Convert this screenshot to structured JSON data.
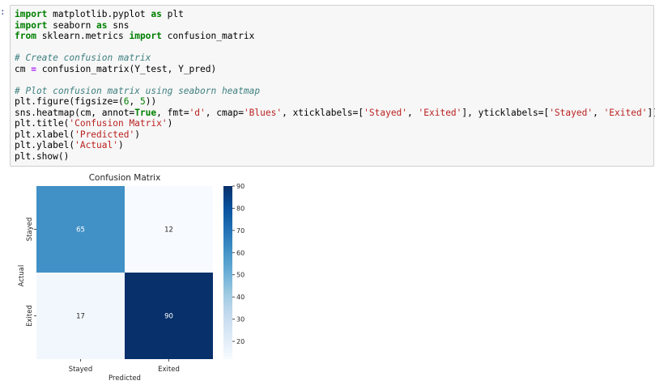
{
  "cell": {
    "prompt": ":",
    "lines": [
      [
        {
          "t": "import",
          "c": "kw"
        },
        {
          "t": " matplotlib.pyplot ",
          "c": ""
        },
        {
          "t": "as",
          "c": "kw"
        },
        {
          "t": " plt",
          "c": ""
        }
      ],
      [
        {
          "t": "import",
          "c": "kw"
        },
        {
          "t": " seaborn ",
          "c": ""
        },
        {
          "t": "as",
          "c": "kw"
        },
        {
          "t": " sns",
          "c": ""
        }
      ],
      [
        {
          "t": "from",
          "c": "kw"
        },
        {
          "t": " sklearn.metrics ",
          "c": ""
        },
        {
          "t": "import",
          "c": "kw"
        },
        {
          "t": " confusion_matrix",
          "c": ""
        }
      ],
      [],
      [
        {
          "t": "# Create confusion matrix",
          "c": "cm"
        }
      ],
      [
        {
          "t": "cm ",
          "c": ""
        },
        {
          "t": "=",
          "c": "op"
        },
        {
          "t": " confusion_matrix(Y_test, Y_pred)",
          "c": ""
        }
      ],
      [],
      [
        {
          "t": "# Plot confusion matrix using seaborn heatmap",
          "c": "cm"
        }
      ],
      [
        {
          "t": "plt.figure(figsize=(",
          "c": ""
        },
        {
          "t": "6",
          "c": "nu"
        },
        {
          "t": ", ",
          "c": ""
        },
        {
          "t": "5",
          "c": "nu"
        },
        {
          "t": "))",
          "c": ""
        }
      ],
      [
        {
          "t": "sns.heatmap(cm, annot=",
          "c": ""
        },
        {
          "t": "True",
          "c": "kw"
        },
        {
          "t": ", fmt=",
          "c": ""
        },
        {
          "t": "'d'",
          "c": "st"
        },
        {
          "t": ", cmap=",
          "c": ""
        },
        {
          "t": "'Blues'",
          "c": "st"
        },
        {
          "t": ", xticklabels=[",
          "c": ""
        },
        {
          "t": "'Stayed'",
          "c": "st"
        },
        {
          "t": ", ",
          "c": ""
        },
        {
          "t": "'Exited'",
          "c": "st"
        },
        {
          "t": "], yticklabels=[",
          "c": ""
        },
        {
          "t": "'Stayed'",
          "c": "st"
        },
        {
          "t": ", ",
          "c": ""
        },
        {
          "t": "'Exited'",
          "c": "st"
        },
        {
          "t": "])",
          "c": ""
        }
      ],
      [
        {
          "t": "plt.title(",
          "c": ""
        },
        {
          "t": "'Confusion Matrix'",
          "c": "st"
        },
        {
          "t": ")",
          "c": ""
        }
      ],
      [
        {
          "t": "plt.xlabel(",
          "c": ""
        },
        {
          "t": "'Predicted'",
          "c": "st"
        },
        {
          "t": ")",
          "c": ""
        }
      ],
      [
        {
          "t": "plt.ylabel(",
          "c": ""
        },
        {
          "t": "'Actual'",
          "c": "st"
        },
        {
          "t": ")",
          "c": ""
        }
      ],
      [
        {
          "t": "plt.show()",
          "c": ""
        }
      ]
    ]
  },
  "chart_data": {
    "type": "heatmap",
    "title": "Confusion Matrix",
    "xlabel": "Predicted",
    "ylabel": "Actual",
    "x_categories": [
      "Stayed",
      "Exited"
    ],
    "y_categories": [
      "Stayed",
      "Exited"
    ],
    "values": [
      [
        65,
        12
      ],
      [
        17,
        90
      ]
    ],
    "colormap": "Blues",
    "vmin": 12,
    "vmax": 90,
    "colorbar_ticks": [
      20,
      30,
      40,
      50,
      60,
      70,
      80,
      90
    ],
    "cell_colors": [
      [
        "#4191c6",
        "#f7fbff"
      ],
      [
        "#f2f7fd",
        "#08306b"
      ]
    ],
    "annotation_colors": [
      [
        "#ffffff",
        "#262626"
      ],
      [
        "#262626",
        "#ffffff"
      ]
    ]
  }
}
